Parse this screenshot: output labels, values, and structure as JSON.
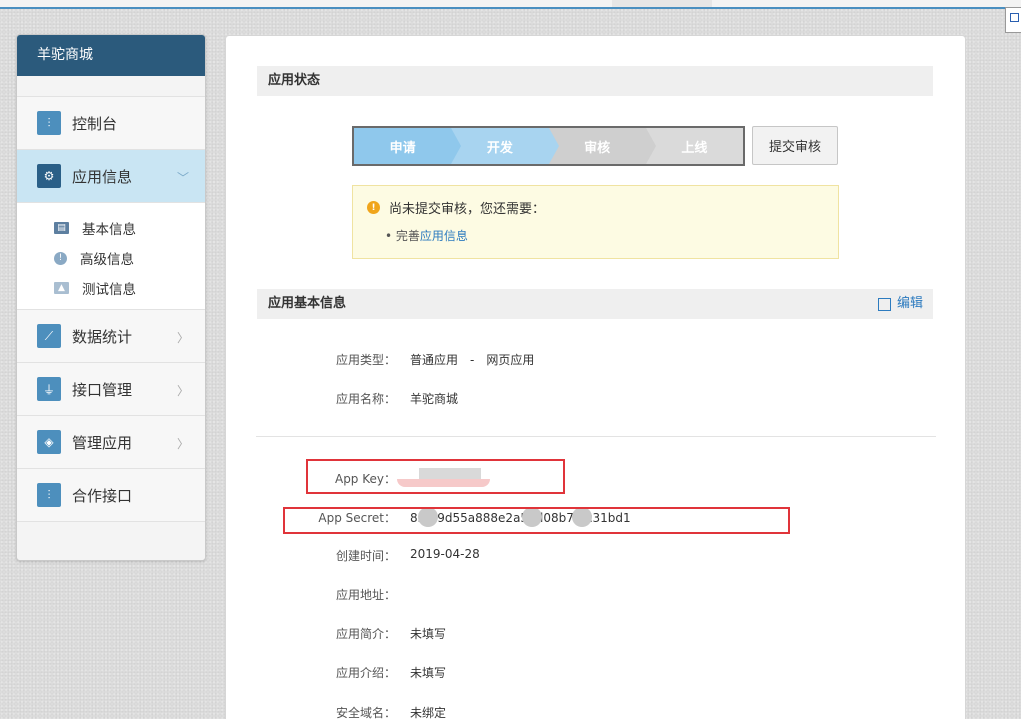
{
  "sidebar": {
    "brand": "羊驼商城",
    "items": [
      {
        "label": "控制台",
        "icon": "sliders-icon"
      },
      {
        "label": "应用信息",
        "icon": "gear-icon",
        "active": true,
        "sub": [
          {
            "label": "基本信息",
            "icon": "id-card-icon"
          },
          {
            "label": "高级信息",
            "icon": "info-circle-icon"
          },
          {
            "label": "测试信息",
            "icon": "image-icon"
          }
        ]
      },
      {
        "label": "数据统计",
        "icon": "line-chart-icon"
      },
      {
        "label": "接口管理",
        "icon": "plug-icon"
      },
      {
        "label": "管理应用",
        "icon": "layers-icon"
      },
      {
        "label": "合作接口",
        "icon": "sliders-icon"
      }
    ]
  },
  "status_section": {
    "title": "应用状态",
    "steps": [
      "申请",
      "开发",
      "审核",
      "上线"
    ],
    "submit_button": "提交审核",
    "notice": {
      "message": "尚未提交审核，您还需要：",
      "todo_prefix": "完善",
      "todo_link": "应用信息"
    }
  },
  "basic_section": {
    "title": "应用基本信息",
    "edit_label": "编辑",
    "fields": {
      "type_label": "应用类型：",
      "type_value": "普通应用　-　网页应用",
      "name_label": "应用名称：",
      "name_value": "羊驼商城",
      "appkey_label": "App Key：",
      "appkey_value": "",
      "secret_label": "App Secret：",
      "secret_value": "83　9d55a888e2a5　l08b7　c31bd1",
      "created_label": "创建时间：",
      "created_value": "2019-04-28",
      "url_label": "应用地址：",
      "url_value": "",
      "brief_label": "应用简介：",
      "brief_value": "未填写",
      "intro_label": "应用介绍：",
      "intro_value": "未填写",
      "domain_label": "安全域名：",
      "domain_value": "未绑定"
    }
  },
  "colors": {
    "brand_bar": "#2b5a7c",
    "active_nav": "#c9e5f3",
    "link": "#2d7bbf",
    "highlight_box": "#e0343a"
  }
}
